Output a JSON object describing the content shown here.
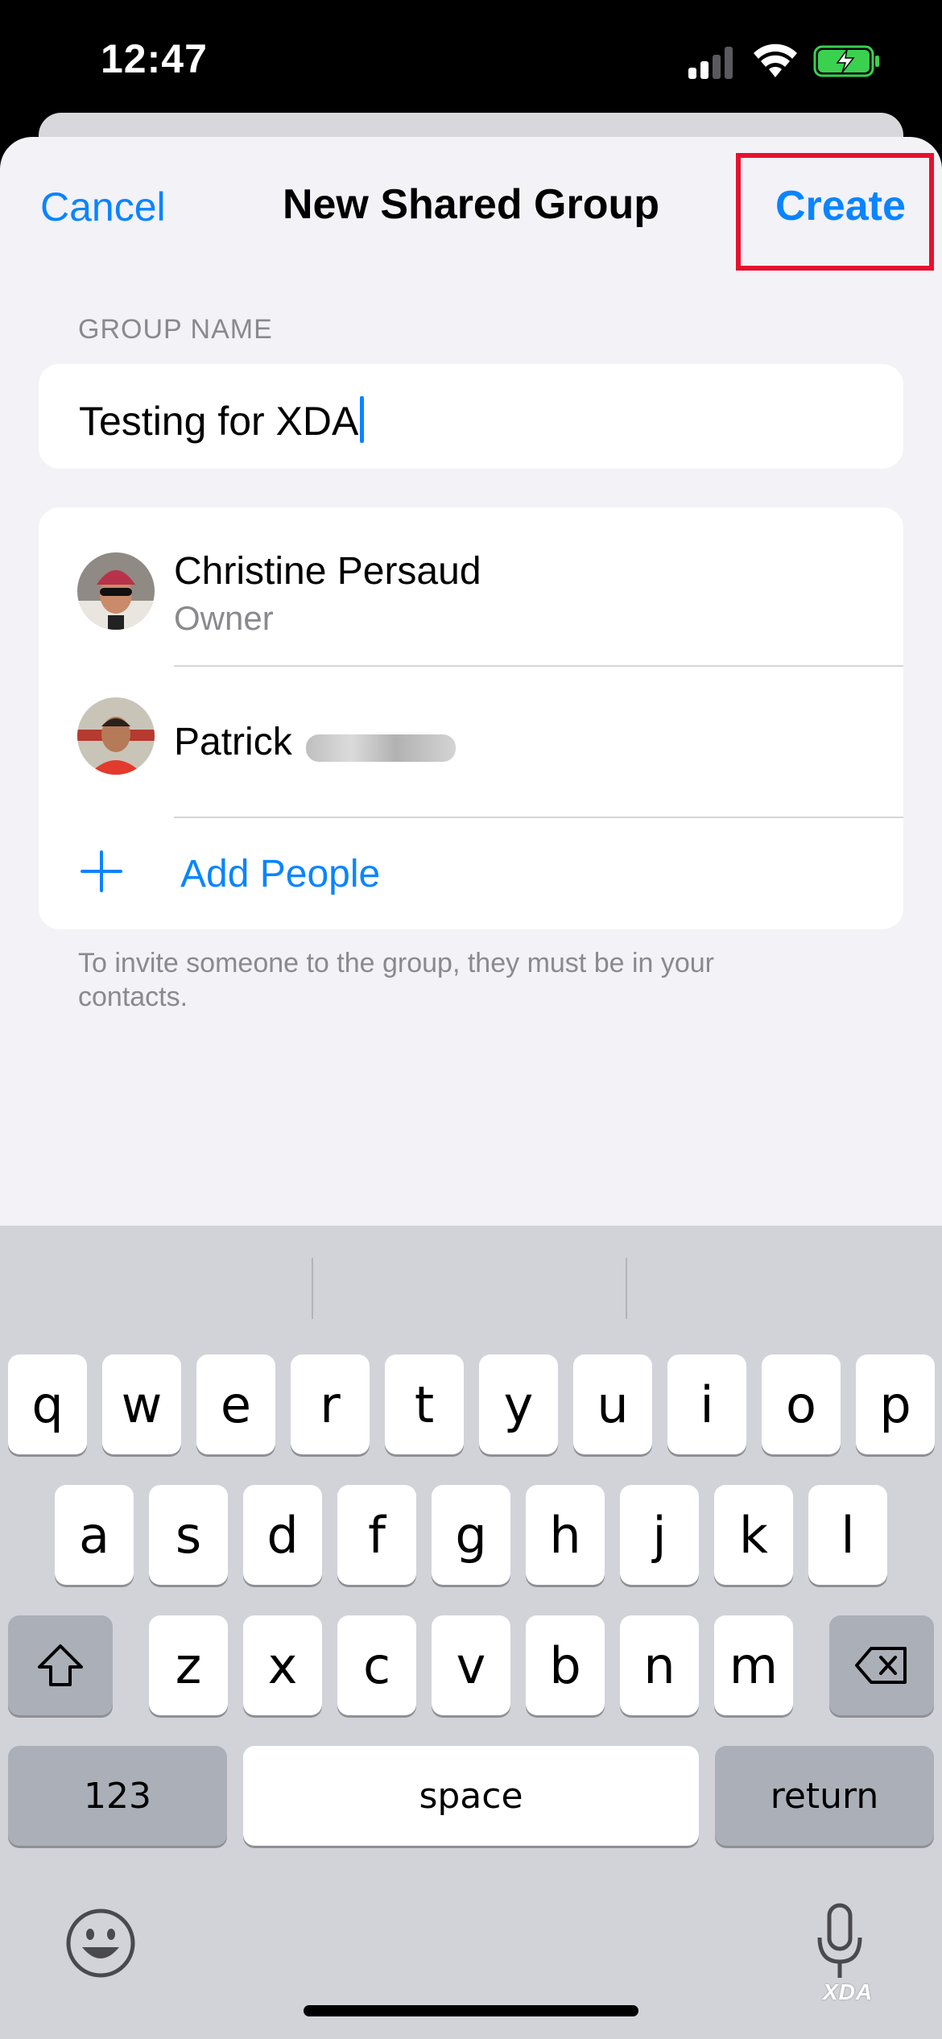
{
  "status_bar": {
    "time": "12:47"
  },
  "nav": {
    "cancel_label": "Cancel",
    "title": "New Shared Group",
    "create_label": "Create"
  },
  "group_name": {
    "header": "GROUP NAME",
    "value": "Testing for XDA"
  },
  "members": [
    {
      "name": "Christine Persaud",
      "role": "Owner"
    },
    {
      "name": "Patrick"
    }
  ],
  "add_people_label": "Add People",
  "footer_note": "To invite someone to the group, they must be in your contacts.",
  "keyboard": {
    "row1": [
      "q",
      "w",
      "e",
      "r",
      "t",
      "y",
      "u",
      "i",
      "o",
      "p"
    ],
    "row2": [
      "a",
      "s",
      "d",
      "f",
      "g",
      "h",
      "j",
      "k",
      "l"
    ],
    "row3": [
      "z",
      "x",
      "c",
      "v",
      "b",
      "n",
      "m"
    ],
    "numbers_label": "123",
    "space_label": "space",
    "return_label": "return"
  },
  "watermark": "XDA",
  "colors": {
    "accent": "#0a84ff",
    "highlight": "#e8102e",
    "background": "#f2f2f7",
    "keyboard": "#d1d3d9"
  }
}
